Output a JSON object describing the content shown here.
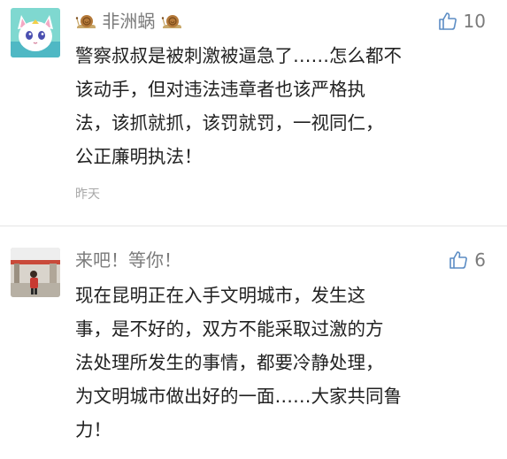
{
  "comments": [
    {
      "username": "非洲蜗",
      "likes": "10",
      "lines": [
        "警察叔叔是被刺激被逼急了……怎么都不",
        "该动手，但对违法违章者也该严格执",
        "法，该抓就抓，该罚就罚，一视同仁，",
        "公正廉明执法！"
      ],
      "time": "昨天",
      "avatar_icon": "cartoon-cat-avatar-icon"
    },
    {
      "username": "来吧！等你！",
      "likes": "6",
      "lines": [
        "现在昆明正在入手文明城市，发生这",
        "事，是不好的，双方不能采取过激的方",
        "法处理所发生的事情，都要冷静处理，",
        "为文明城市做出好的一面……大家共同鲁",
        "力！"
      ],
      "avatar_icon": "photo-avatar-icon"
    }
  ],
  "colors": {
    "username": "#7b7b7b",
    "text": "#222222",
    "meta": "#a8a8a8",
    "like_icon": "#5b8cc4",
    "divider": "#e5e5e5"
  },
  "icons": {
    "like": "thumbs-up-icon",
    "snail": "snail-icon"
  }
}
